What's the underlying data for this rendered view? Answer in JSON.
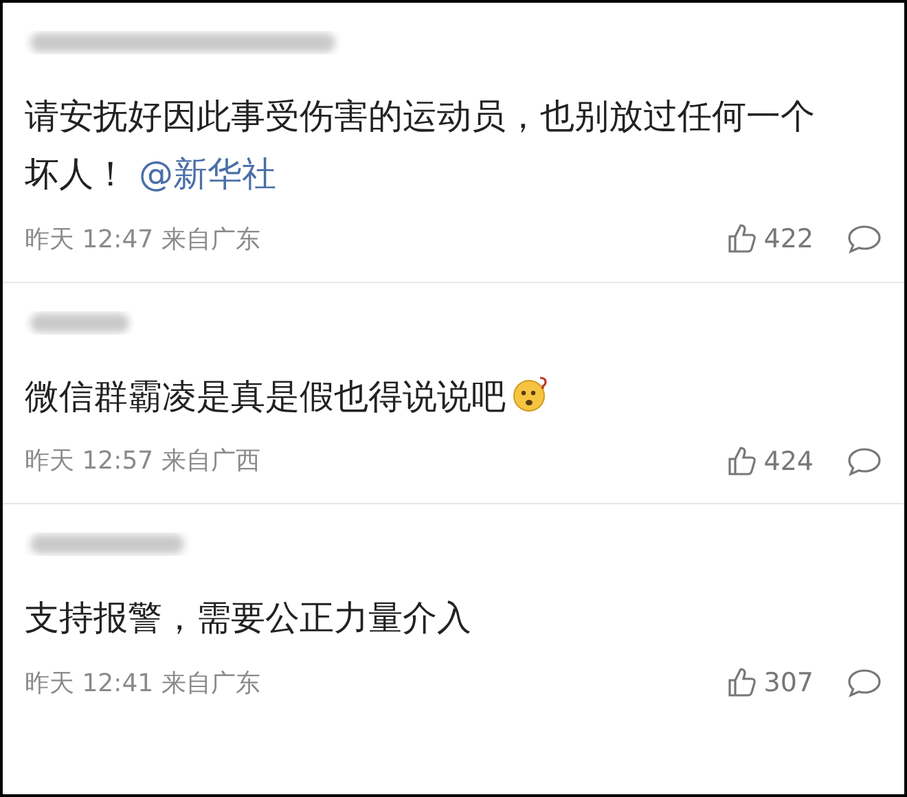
{
  "comments": [
    {
      "text": "请安抚好因此事受伤害的运动员，也别放过任何一个坏人！",
      "mention": "@新华社",
      "emoji": false,
      "meta": "昨天 12:47 来自广东",
      "likes": "422"
    },
    {
      "text": "微信群霸凌是真是假也得说说吧",
      "emoji": true,
      "meta": "昨天 12:57 来自广西",
      "likes": "424"
    },
    {
      "text": "支持报警，需要公正力量介入",
      "emoji": false,
      "meta": "昨天 12:41 来自广东",
      "likes": "307"
    }
  ]
}
